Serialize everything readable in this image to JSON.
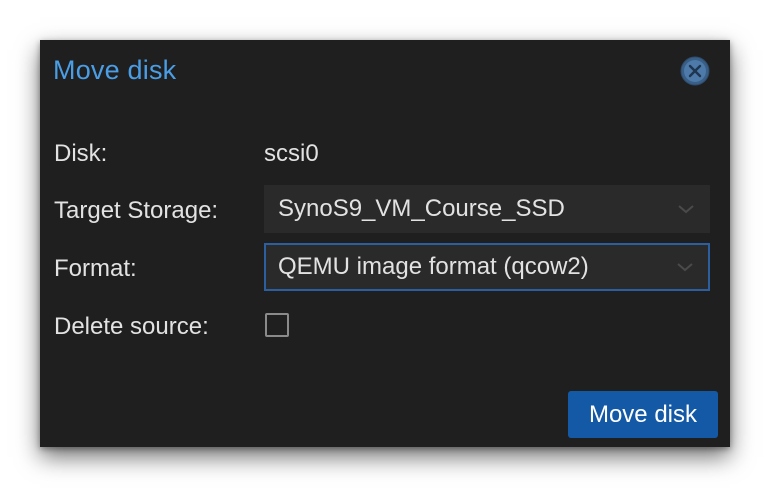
{
  "dialog": {
    "title": "Move disk",
    "close_icon": "close-circle-icon",
    "fields": {
      "disk": {
        "label": "Disk:",
        "value": "scsi0"
      },
      "target_storage": {
        "label": "Target Storage:",
        "value": "SynoS9_VM_Course_SSD"
      },
      "format": {
        "label": "Format:",
        "value": "QEMU image format (qcow2)"
      },
      "delete_source": {
        "label": "Delete source:",
        "checked": false
      }
    },
    "submit_label": "Move disk"
  },
  "colors": {
    "title": "#4a9ee6",
    "background": "#1f1f1f",
    "primary_button": "#1459a6",
    "focus_border": "#2c5fa0"
  }
}
